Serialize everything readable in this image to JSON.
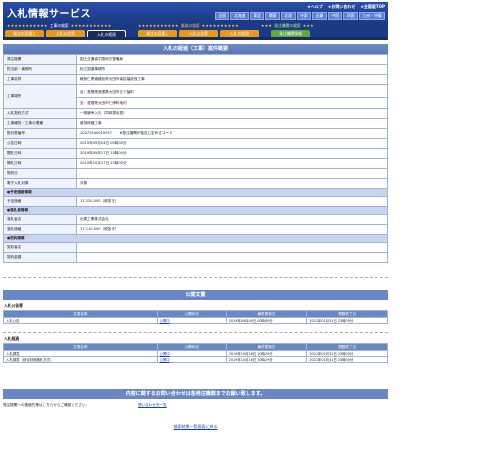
{
  "header": {
    "logo": "入札情報サービス",
    "links": [
      "★ヘルプ",
      "★お問い合わせ",
      "★全国版TOP"
    ],
    "regions": [
      "全国",
      "北海道",
      "東北",
      "関東",
      "北陸",
      "中部",
      "近畿",
      "中国",
      "四国",
      "九州・沖縄"
    ]
  },
  "categories": [
    {
      "stars_left": "★★★★★★★★★★★",
      "label": "工事の検索",
      "stars_right": "★★★★★★★★★★★"
    },
    {
      "stars_left": "★★★★★★★★★★★",
      "label": "業務の検索",
      "stars_right": "★★★★★★★★★★"
    },
    {
      "stars_left": "★★★",
      "label": "発注機関の検索",
      "stars_right": "★★★"
    }
  ],
  "tabs": [
    "発注の見通し",
    "入札公告等",
    "入札の経過",
    "発注の見通し",
    "入札公告等",
    "入札の経過",
    "発注機関情報"
  ],
  "main": {
    "title": "入札の経過（工事）案件概要",
    "rows": [
      {
        "label": "発注機関",
        "value": "国土交通省中国地方整備局"
      },
      {
        "label": "担当部・事務所",
        "value": "松江国道事務所"
      },
      {
        "label": "工事名称",
        "value": "鞍掛仁摩道路仮称大田市南拡幅改良工事"
      },
      {
        "label": "工事場所",
        "values": [
          "自：島根県島根県大田市五十猛町",
          "至：島根県大田市仁摩町地内"
        ]
      },
      {
        "label": "入札契約方式",
        "value": "一般競争入札（同時提出型）"
      },
      {
        "label": "工事種別／工事の業種",
        "value": "維持修繕工事"
      },
      {
        "label": "設計書番号",
        "value": "10072540010057　　★発注機関が独自に定めるコード"
      },
      {
        "label": "公告日時",
        "value": "2019年09月04日 00時00分"
      },
      {
        "label": "開札日時",
        "value": "2019年09月17日 15時00分"
      },
      {
        "label": "開札日時",
        "value": "2019年10月17日 15時00分"
      },
      {
        "label": "契約日",
        "value": ""
      },
      {
        "label": "電子入札対象",
        "value": "対象"
      }
    ],
    "group_price": "●予定価格情報",
    "price_label": "予定価格",
    "price_value": "17,220,000（税抜き）",
    "group_bid": "●落札者情報",
    "winner_label": "落札者名",
    "winner_value": "出雲工業株式会社",
    "bid_label": "落札価格",
    "bid_value": "17,110,000（税抜き）",
    "group_contract": "●契約情報",
    "contractor_label": "契約者名",
    "contract_amount_label": "契約金額"
  },
  "docs": {
    "title": "公開文書",
    "sections": [
      {
        "heading": "入札公告等",
        "columns": [
          "文書名称",
          "公開状況",
          "最終更新日",
          "掲載終了日"
        ],
        "rows": [
          [
            "入札公告",
            "公開中",
            "2019年09月04日 00時00分",
            "2021年01月31日 23時00分"
          ]
        ]
      },
      {
        "heading": "入札経過",
        "columns": [
          "文書名称",
          "公開状況",
          "最終更新日",
          "掲載終了日"
        ],
        "rows": [
          [
            "入札調書",
            "公開中",
            "2019年10月16日 10時29分",
            "2021年01月31日 23時00分"
          ],
          [
            "入札調書（総合評価落札方式）",
            "公開中",
            "2019年10月16日 10時29分",
            "2021年01月31日 23時00分"
          ]
        ]
      }
    ]
  },
  "contact": {
    "title": "内容に関するお問い合わせは各発注機関までお願い致します。",
    "text": "発注機関への連絡先等はこちらからご確認ください。",
    "link": "問い合わせ先一覧"
  },
  "back_link": "検索結果一覧画面に戻る"
}
